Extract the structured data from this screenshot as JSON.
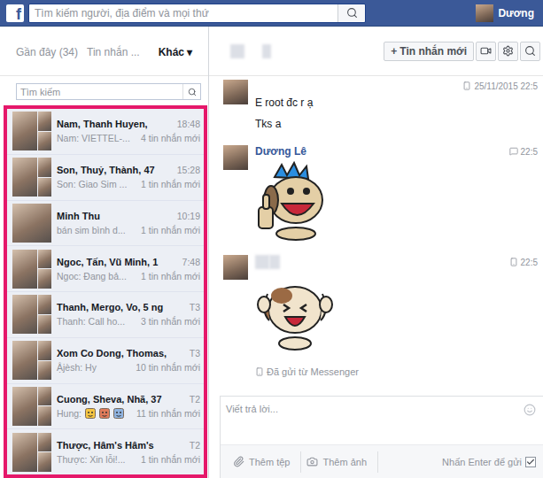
{
  "topbar": {
    "logo": "f",
    "search_placeholder": "Tìm kiếm người, địa điểm và mọi thứ",
    "user": "Dương"
  },
  "inbox": {
    "tabs": [
      {
        "label": "Gần đây (34)",
        "selected": false
      },
      {
        "label": "Tin nhắn ...",
        "selected": false
      }
    ],
    "more": {
      "label": "Khác",
      "arrow": "▾"
    },
    "search_placeholder": "Tìm kiếm"
  },
  "conversations": [
    {
      "kind": "group",
      "name": "Nam, Thanh Huyen,",
      "time": "18:48",
      "preview": "Nam: VIETTEL-...",
      "preview_icons": 0,
      "count": "4 tin nhắn mới"
    },
    {
      "kind": "group",
      "name": "Son, Thuỷ, Thành, 47",
      "time": "15:28",
      "preview": "Son: Giao Sim ...",
      "preview_icons": 0,
      "count": "1 tin nhắn mới"
    },
    {
      "kind": "single",
      "name": "Minh Thu",
      "time": "10:19",
      "preview": "bán sim bình d...",
      "preview_icons": 0,
      "count": "1 tin nhắn mới"
    },
    {
      "kind": "group",
      "name": "Ngoc, Tấn, Vũ Minh, 1",
      "time": "7:48",
      "preview": "Ngoc: Đang bả...",
      "preview_icons": 0,
      "count": "1 tin nhắn mới"
    },
    {
      "kind": "group",
      "name": "Thanh, Mergo, Vo, 5 ng",
      "time": "T3",
      "preview": "Thanh: Call ho...",
      "preview_icons": 0,
      "count": "3 tin nhắn mới"
    },
    {
      "kind": "group",
      "name": "Xom Co Dong, Thomas,",
      "time": "T3",
      "preview": "Ậjèsh: Hy",
      "preview_icons": 0,
      "count": "10 tin nhắn mới"
    },
    {
      "kind": "group",
      "name": "Cuong, Sheva, Nhã, 37",
      "time": "T2",
      "preview": "Hung:",
      "preview_icons": 3,
      "count": "11 tin nhắn mới"
    },
    {
      "kind": "group",
      "name": "Thược, Hâm's Hâm's",
      "time": "T2",
      "preview": "Thược: Xin lỗi!...",
      "preview_icons": 0,
      "count": "1 tin nhắn mới"
    }
  ],
  "thread": {
    "recipient_hidden": true,
    "new_message": {
      "icon": "+",
      "label": "Tin nhắn mới"
    },
    "messages": [
      {
        "kind": "text",
        "show_sender": false,
        "sender": "",
        "sender_hidden": false,
        "time": "25/11/2015 22:5",
        "via": "mobile",
        "lines": [
          "E root đc r ạ",
          "Tks a"
        ]
      },
      {
        "kind": "thumbsup",
        "show_sender": true,
        "sender": "Dương Lê",
        "sender_hidden": false,
        "time": "22:5",
        "via": "web",
        "lines": []
      },
      {
        "kind": "cheer",
        "show_sender": true,
        "sender": "",
        "sender_hidden": true,
        "time": "22:5",
        "via": "mobile",
        "lines": []
      }
    ],
    "sent_from": "Đã gửi từ Messenger"
  },
  "composer": {
    "placeholder": "Viết trả lời...",
    "attach_file": "Thêm tệp",
    "attach_photo": "Thêm ảnh",
    "enter_to_send": "Nhấn Enter để gửi",
    "enter_to_send_checked": true
  }
}
